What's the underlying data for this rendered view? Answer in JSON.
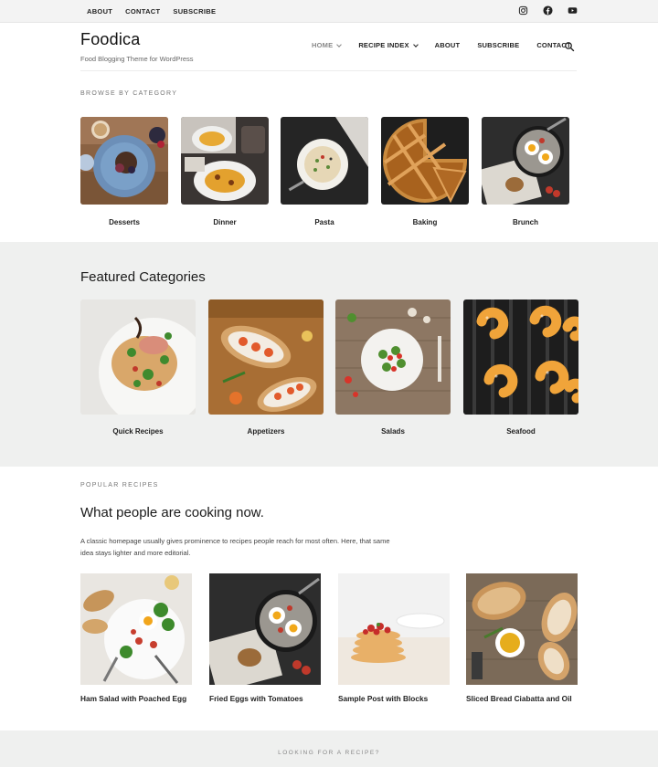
{
  "topbar": {
    "links": [
      "ABOUT",
      "CONTACT",
      "SUBSCRIBE"
    ],
    "socials": [
      "instagram-icon",
      "facebook-icon",
      "youtube-icon"
    ]
  },
  "header": {
    "brand": "Foodica",
    "tagline": "Food Blogging Theme for WordPress",
    "nav": [
      {
        "label": "HOME",
        "dropdown": true
      },
      {
        "label": "RECIPE INDEX",
        "dropdown": true
      },
      {
        "label": "ABOUT",
        "dropdown": false
      },
      {
        "label": "SUBSCRIBE",
        "dropdown": false
      },
      {
        "label": "CONTACT",
        "dropdown": false
      }
    ],
    "search_icon": "search-icon"
  },
  "browse": {
    "label": "BROWSE BY CATEGORY",
    "categories": [
      "Desserts",
      "Dinner",
      "Pasta",
      "Baking",
      "Brunch"
    ]
  },
  "featured": {
    "title": "Featured Categories",
    "categories": [
      "Quick Recipes",
      "Appetizers",
      "Salads",
      "Seafood"
    ]
  },
  "popular": {
    "label": "POPULAR RECIPES",
    "title": "What people are cooking now.",
    "description": "A classic homepage usually gives prominence to recipes people reach for most often. Here, that same idea stays lighter and more editorial.",
    "recipes": [
      "Ham Salad with Poached Egg",
      "Fried Eggs with Tomatoes",
      "Sample Post with Blocks",
      "Sliced Bread Ciabatta and Oil"
    ]
  },
  "footer_band": {
    "label": "LOOKING FOR A RECIPE?"
  },
  "colors": {
    "band_bg": "#eff0ef",
    "topbar_bg": "#f3f3f3",
    "text": "#222222",
    "muted": "#777777"
  }
}
